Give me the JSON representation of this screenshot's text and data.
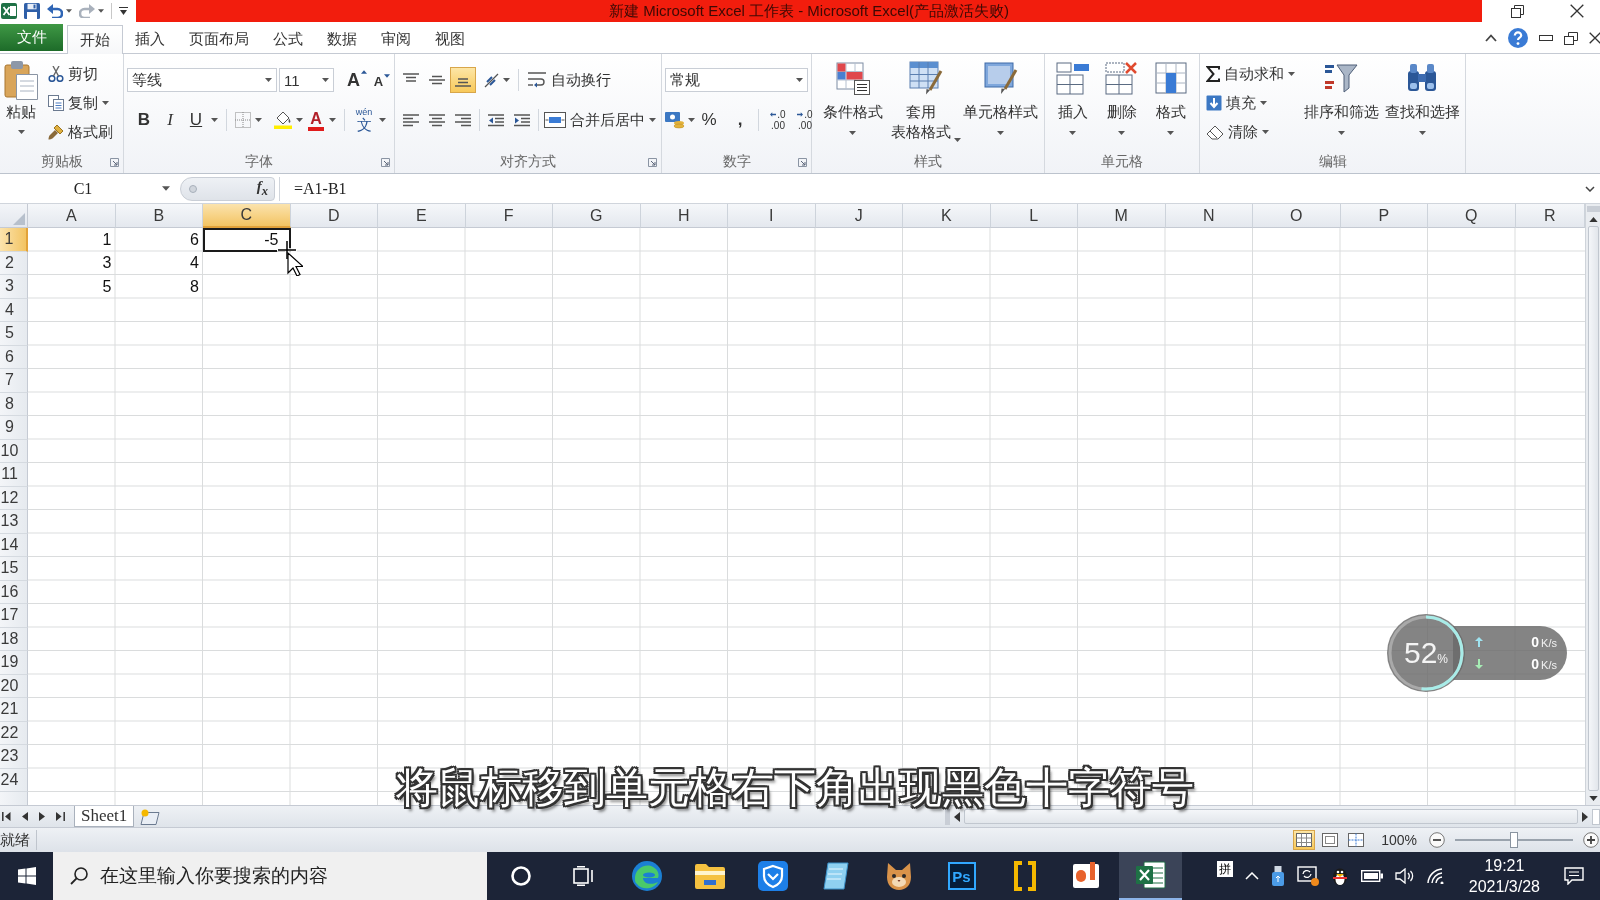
{
  "title_bar": {
    "title": "新建 Microsoft Excel 工作表 - Microsoft Excel(产品激活失败)"
  },
  "menu_tabs": [
    {
      "label": "文件",
      "kind": "file",
      "selected": false
    },
    {
      "label": "开始",
      "kind": "tab",
      "selected": true
    },
    {
      "label": "插入",
      "kind": "tab",
      "selected": false
    },
    {
      "label": "页面布局",
      "kind": "tab",
      "selected": false
    },
    {
      "label": "公式",
      "kind": "tab",
      "selected": false
    },
    {
      "label": "数据",
      "kind": "tab",
      "selected": false
    },
    {
      "label": "审阅",
      "kind": "tab",
      "selected": false
    },
    {
      "label": "视图",
      "kind": "tab",
      "selected": false
    }
  ],
  "ribbon": {
    "groups": [
      {
        "kind": "clipboard",
        "label": "剪贴板",
        "launcher": true,
        "paste": "粘贴",
        "items": [
          {
            "kind": "cut",
            "label": "剪切"
          },
          {
            "kind": "copy",
            "label": "复制"
          },
          {
            "kind": "painter",
            "label": "格式刷"
          }
        ]
      },
      {
        "kind": "font",
        "label": "字体",
        "launcher": true,
        "font_name": "等线",
        "font_size": "11",
        "grow": "A",
        "shrink": "A",
        "styles": [
          {
            "kind": "bold",
            "label": "B"
          },
          {
            "kind": "italic",
            "label": "I"
          },
          {
            "kind": "underline",
            "label": "U"
          }
        ],
        "font_color": "A",
        "phonetic": {
          "ruby": "wén",
          "base": "文"
        }
      },
      {
        "kind": "alignment",
        "label": "对齐方式",
        "launcher": true,
        "vertical": [
          {
            "kind": "top",
            "selected": false
          },
          {
            "kind": "middle",
            "selected": false
          },
          {
            "kind": "bottom",
            "selected": true
          }
        ],
        "horizontal": [
          {
            "kind": "left",
            "selected": false
          },
          {
            "kind": "center",
            "selected": false
          },
          {
            "kind": "right",
            "selected": false
          }
        ],
        "wrap": "自动换行",
        "merge": "合并后居中"
      },
      {
        "kind": "number",
        "label": "数字",
        "launcher": true,
        "format": "常规",
        "percent": "%",
        "comma": ",",
        "decimals": [
          {
            "kind": "increase",
            "top": ".0",
            "bottom": ".00"
          },
          {
            "kind": "decrease",
            "top": ".0",
            "bottom": ".00"
          }
        ]
      },
      {
        "kind": "styles",
        "label": "样式",
        "launcher": false,
        "buttons": [
          {
            "kind": "conditional",
            "lines": [
              "条件格式"
            ]
          },
          {
            "kind": "table",
            "lines": [
              "套用",
              "表格格式"
            ]
          },
          {
            "kind": "cellstyle",
            "lines": [
              "单元格样式"
            ]
          }
        ]
      },
      {
        "kind": "cells",
        "label": "单元格",
        "launcher": false,
        "buttons": [
          {
            "kind": "insert",
            "lines": [
              "插入"
            ]
          },
          {
            "kind": "delete",
            "lines": [
              "删除"
            ]
          },
          {
            "kind": "format",
            "lines": [
              "格式"
            ]
          }
        ]
      },
      {
        "kind": "editing",
        "label": "编辑",
        "launcher": false,
        "small": [
          {
            "kind": "sum",
            "label": "自动求和"
          },
          {
            "kind": "fill",
            "label": "填充"
          },
          {
            "kind": "clear",
            "label": "清除"
          }
        ],
        "buttons": [
          {
            "kind": "sort",
            "lines": [
              "排序和筛选"
            ]
          },
          {
            "kind": "find",
            "lines": [
              "查找和选择"
            ]
          }
        ]
      }
    ]
  },
  "formula_bar": {
    "name_box": "C1",
    "function_button": "f$_{x}$",
    "formula": "=A1-B1"
  },
  "sheet": {
    "columns": [
      {
        "label": "A",
        "selected": false
      },
      {
        "label": "B",
        "selected": false
      },
      {
        "label": "C",
        "selected": true
      },
      {
        "label": "D",
        "selected": false
      },
      {
        "label": "E",
        "selected": false
      },
      {
        "label": "F",
        "selected": false
      },
      {
        "label": "G",
        "selected": false
      },
      {
        "label": "H",
        "selected": false
      },
      {
        "label": "I",
        "selected": false
      },
      {
        "label": "J",
        "selected": false
      },
      {
        "label": "K",
        "selected": false
      },
      {
        "label": "L",
        "selected": false
      },
      {
        "label": "M",
        "selected": false
      },
      {
        "label": "N",
        "selected": false
      },
      {
        "label": "O",
        "selected": false
      },
      {
        "label": "P",
        "selected": false
      },
      {
        "label": "Q",
        "selected": false
      },
      {
        "label": "R",
        "selected": false
      }
    ],
    "rows": [
      {
        "label": "1",
        "selected": true,
        "cells": [
          {
            "value": "1",
            "selected": false
          },
          {
            "value": "6",
            "selected": false
          },
          {
            "value": "-5",
            "selected": true
          }
        ]
      },
      {
        "label": "2",
        "selected": false,
        "cells": [
          {
            "value": "3",
            "selected": false
          },
          {
            "value": "4",
            "selected": false
          }
        ]
      },
      {
        "label": "3",
        "selected": false,
        "cells": [
          {
            "value": "5",
            "selected": false
          },
          {
            "value": "8",
            "selected": false
          }
        ]
      },
      {
        "label": "4",
        "selected": false
      },
      {
        "label": "5",
        "selected": false
      },
      {
        "label": "6",
        "selected": false
      },
      {
        "label": "7",
        "selected": false
      },
      {
        "label": "8",
        "selected": false
      },
      {
        "label": "9",
        "selected": false
      },
      {
        "label": "10",
        "selected": false
      },
      {
        "label": "11",
        "selected": false
      },
      {
        "label": "12",
        "selected": false
      },
      {
        "label": "13",
        "selected": false
      },
      {
        "label": "14",
        "selected": false
      },
      {
        "label": "15",
        "selected": false
      },
      {
        "label": "16",
        "selected": false
      },
      {
        "label": "17",
        "selected": false
      },
      {
        "label": "18",
        "selected": false
      },
      {
        "label": "19",
        "selected": false
      },
      {
        "label": "20",
        "selected": false
      },
      {
        "label": "21",
        "selected": false
      },
      {
        "label": "22",
        "selected": false
      },
      {
        "label": "23",
        "selected": false
      },
      {
        "label": "24",
        "selected": false
      }
    ]
  },
  "sheet_tabs": [
    {
      "label": "Sheet1",
      "selected": true
    }
  ],
  "status_bar": {
    "status": "就绪",
    "views": [
      {
        "kind": "normal",
        "selected": true
      },
      {
        "kind": "layout",
        "selected": false
      },
      {
        "kind": "pagebreak",
        "selected": false
      }
    ],
    "zoom": "100%",
    "zoom_slider": {
      "level": 0.5
    }
  },
  "subtitle": "将鼠标移到单元格右下角出现黑色十字符号",
  "network_widget": {
    "percent": "52",
    "percent_unit": "%",
    "level": 0.52,
    "speeds": [
      {
        "kind": "up",
        "value": "0",
        "unit": "K/s"
      },
      {
        "kind": "down",
        "value": "0",
        "unit": "K/s"
      }
    ]
  },
  "taskbar": {
    "search_placeholder": "在这里输入你要搜索的内容",
    "apps": [
      {
        "kind": "cortana",
        "selected": false
      },
      {
        "kind": "taskview",
        "selected": false
      },
      {
        "kind": "edge",
        "selected": false
      },
      {
        "kind": "explorer",
        "selected": false
      },
      {
        "kind": "shield",
        "selected": false
      },
      {
        "kind": "notepad",
        "selected": false
      },
      {
        "kind": "cat",
        "selected": false
      },
      {
        "kind": "photoshop",
        "label": "Ps",
        "selected": false
      },
      {
        "kind": "brackets",
        "selected": false
      },
      {
        "kind": "office",
        "selected": false
      },
      {
        "kind": "excel",
        "selected": true
      }
    ],
    "tray": {
      "ime": "拼",
      "time": "19:21",
      "date": "2021/3/28"
    }
  }
}
